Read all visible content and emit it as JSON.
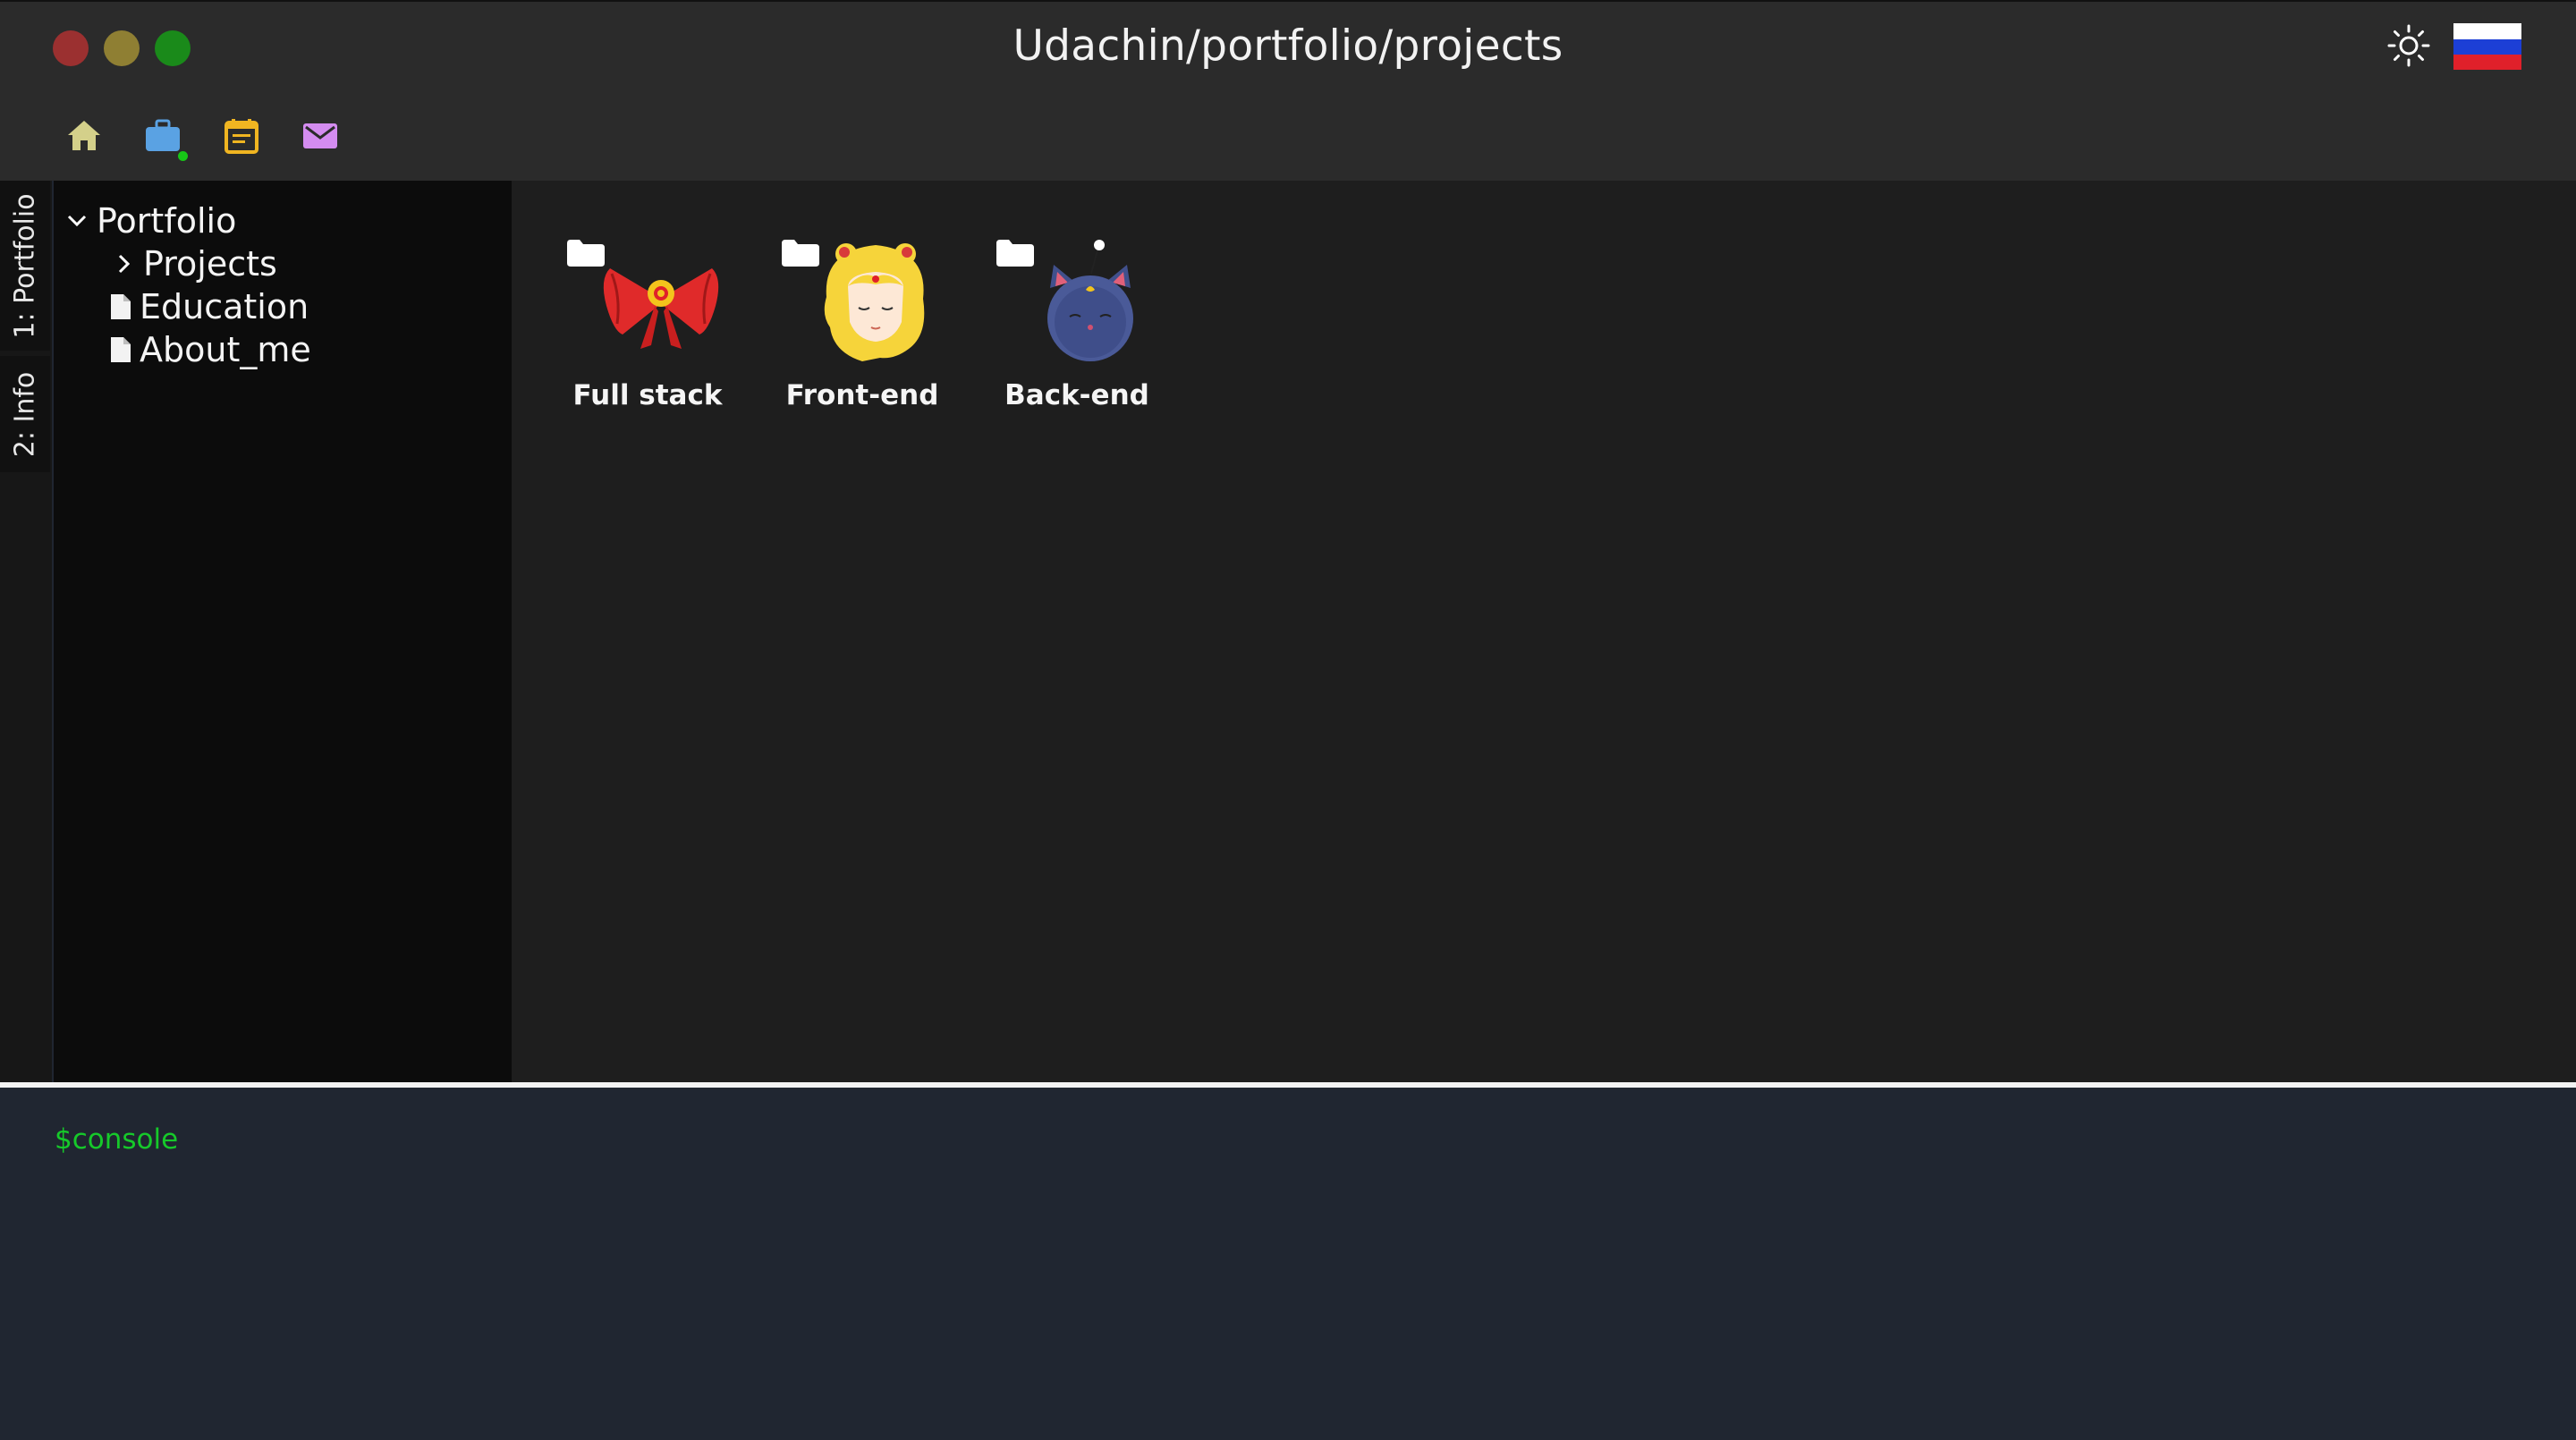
{
  "window": {
    "title": "Udachin/portfolio/projects"
  },
  "header": {
    "theme_icon": "sun-icon",
    "language_flag": "russia-flag-icon"
  },
  "toolbar": {
    "items": [
      {
        "name": "home",
        "icon": "home-icon",
        "color": "#d4d08a"
      },
      {
        "name": "projects",
        "icon": "briefcase-icon",
        "color": "#5aa2e3",
        "status": "online-dot"
      },
      {
        "name": "calendar",
        "icon": "calendar-icon",
        "color": "#f0b521"
      },
      {
        "name": "mail",
        "icon": "mail-icon",
        "color": "#d48cf0"
      }
    ]
  },
  "activity_bar": {
    "tabs": [
      {
        "label": "1: Portfolio"
      },
      {
        "label": "2: Info"
      }
    ]
  },
  "explorer": {
    "root": {
      "label": "Portfolio",
      "expanded": true
    },
    "items": [
      {
        "label": "Projects",
        "type": "folder",
        "expanded": false
      },
      {
        "label": "Education",
        "type": "file"
      },
      {
        "label": "About_me",
        "type": "file"
      }
    ]
  },
  "content": {
    "folders": [
      {
        "label": "Full stack",
        "art": "red-bow-icon"
      },
      {
        "label": "Front-end",
        "art": "sailor-girl-icon"
      },
      {
        "label": "Back-end",
        "art": "cat-face-icon"
      }
    ]
  },
  "console": {
    "prompt": "$console",
    "prompt_color": "#16c92a"
  },
  "colors": {
    "topbar": "#2b2b2b",
    "explorer": "#0c0c0c",
    "content": "#1e1e1e",
    "console": "#202631"
  }
}
